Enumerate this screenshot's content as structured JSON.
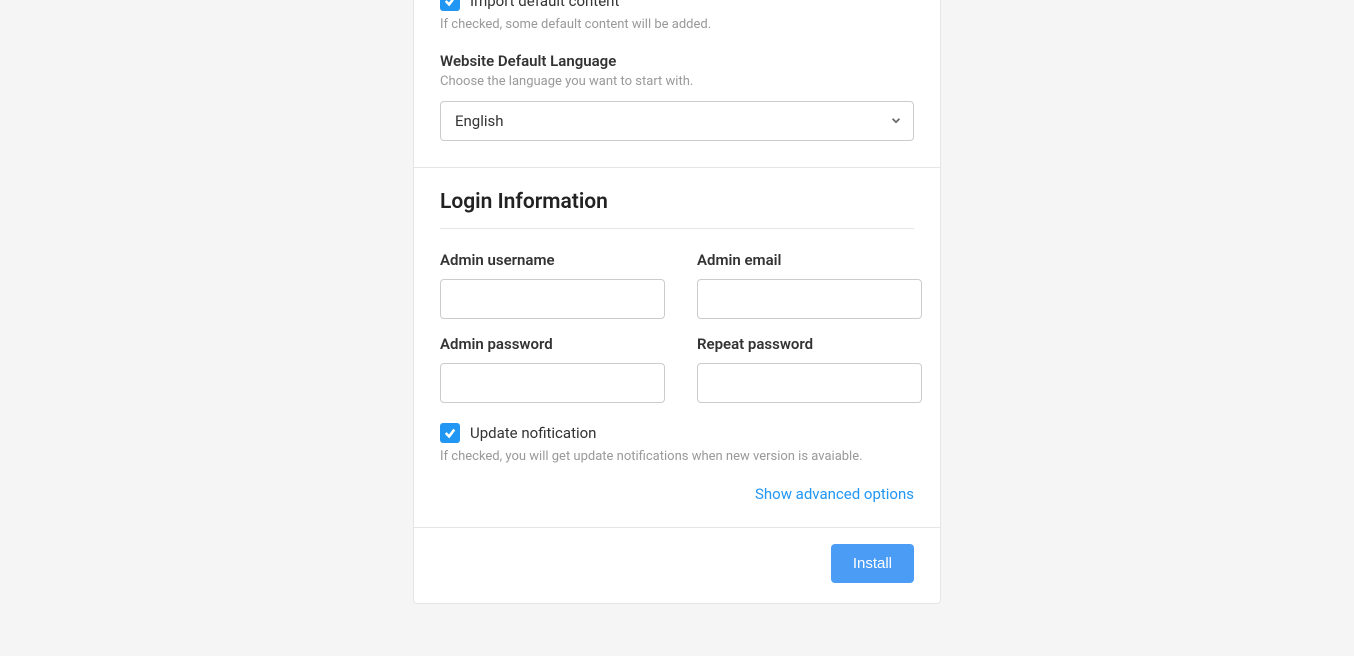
{
  "topSection": {
    "importContent": {
      "label": "Import default content",
      "help": "If checked, some default content will be added."
    },
    "language": {
      "label": "Website Default Language",
      "sub": "Choose the language you want to start with.",
      "selected": "English"
    }
  },
  "login": {
    "title": "Login Information",
    "fields": {
      "username": {
        "label": "Admin username",
        "value": ""
      },
      "email": {
        "label": "Admin email",
        "value": ""
      },
      "password": {
        "label": "Admin password",
        "value": ""
      },
      "repeatPassword": {
        "label": "Repeat password",
        "value": ""
      }
    },
    "updateNotification": {
      "label": "Update nofitication",
      "help": "If checked, you will get update notifications when new version is avaiable."
    },
    "advancedLink": "Show advanced options"
  },
  "footer": {
    "installBtn": "Install"
  }
}
